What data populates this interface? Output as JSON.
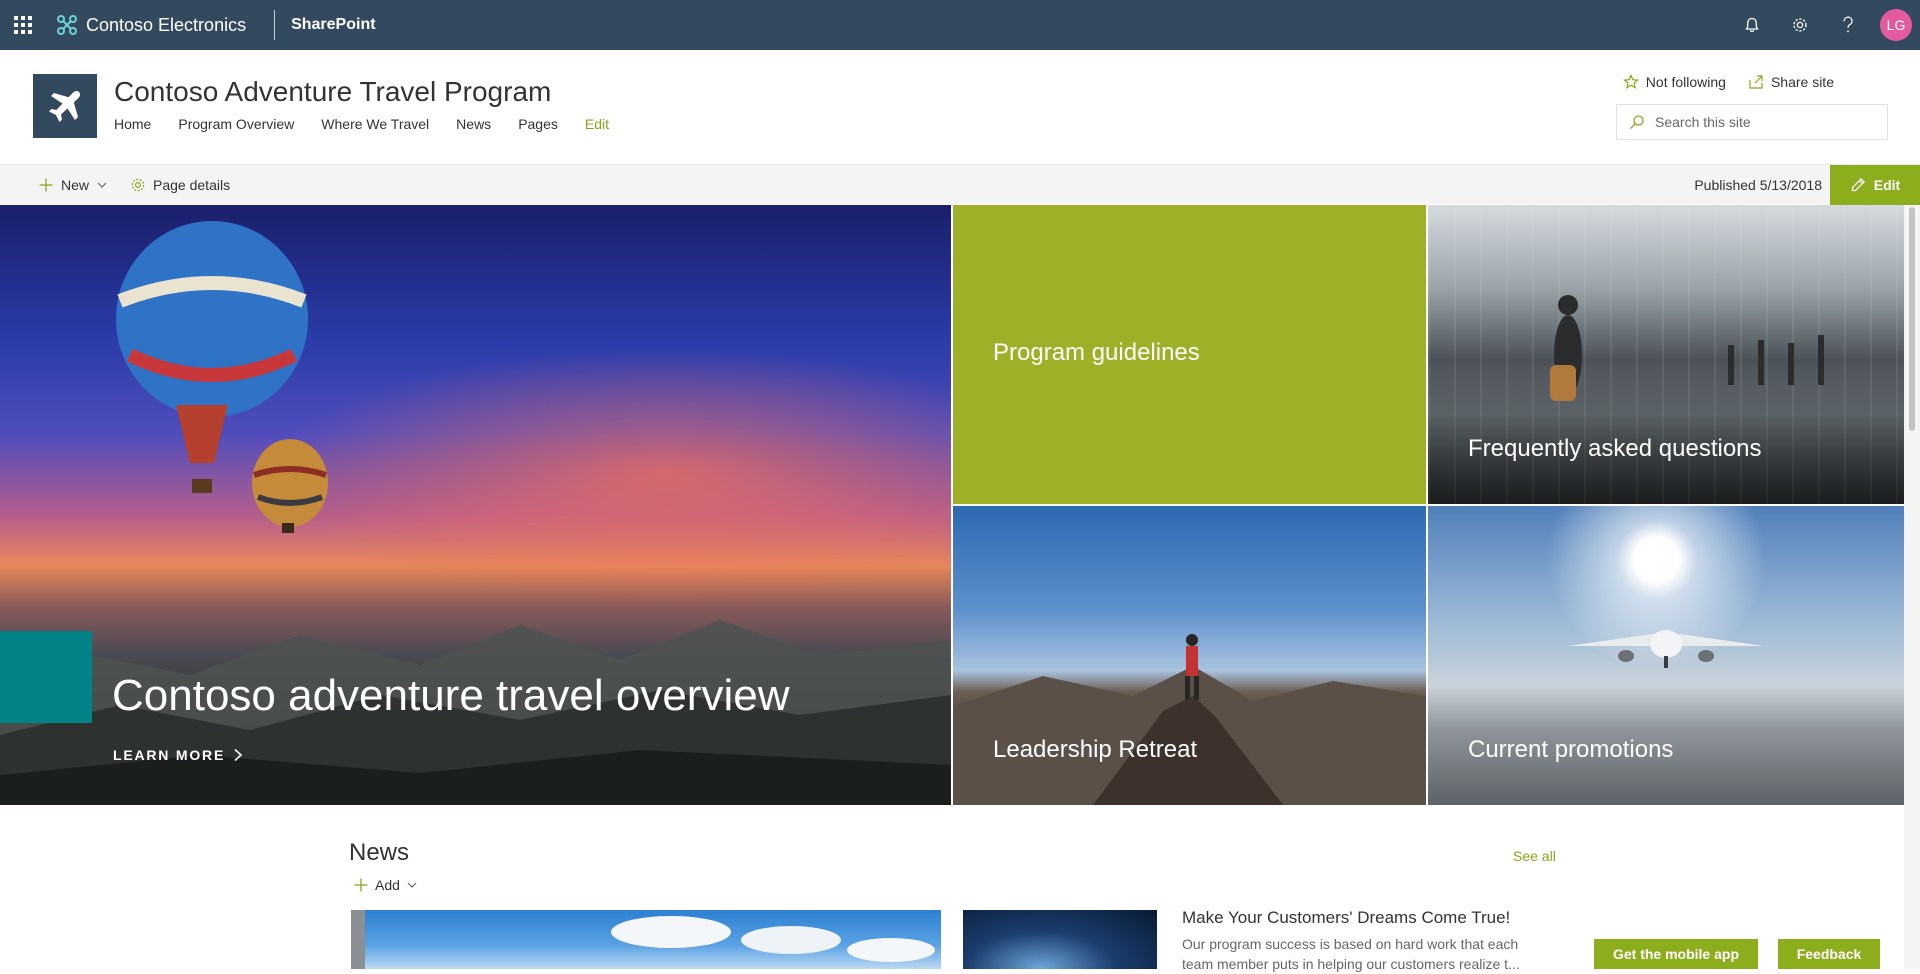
{
  "suite_bar": {
    "org_name": "Contoso Electronics",
    "app_name": "SharePoint",
    "avatar_initials": "LG",
    "icons": [
      "app-launcher-icon",
      "bell-icon",
      "gear-icon",
      "help-icon"
    ],
    "colors": {
      "bar": "#334a5e",
      "avatar": "#e35a9e"
    }
  },
  "site": {
    "title": "Contoso Adventure Travel Program",
    "nav": [
      "Home",
      "Program Overview",
      "Where We Travel",
      "News",
      "Pages",
      "Edit"
    ],
    "follow_label": "Not following",
    "share_label": "Share site",
    "search_placeholder": "Search this site",
    "logo_icon": "airplane-icon"
  },
  "command_bar": {
    "new_label": "New",
    "page_details_label": "Page details",
    "published_label": "Published 5/13/2018",
    "edit_label": "Edit"
  },
  "hero": {
    "main_title": "Contoso adventure travel overview",
    "learn_more": "LEARN MORE",
    "tiles": [
      {
        "label": "Program guidelines"
      },
      {
        "label": "Frequently asked questions"
      },
      {
        "label": "Leadership Retreat"
      },
      {
        "label": "Current promotions"
      }
    ],
    "colors": {
      "accent_green": "#9db027",
      "teal": "#038387"
    }
  },
  "news": {
    "title": "News",
    "see_all": "See all",
    "add_label": "Add",
    "article_headline": "Make Your Customers' Dreams Come True!",
    "article_snippet": "Our program success is based on hard work that each team member puts in helping our customers realize t..."
  },
  "footer_buttons": {
    "mobile_app": "Get the mobile app",
    "feedback": "Feedback"
  }
}
